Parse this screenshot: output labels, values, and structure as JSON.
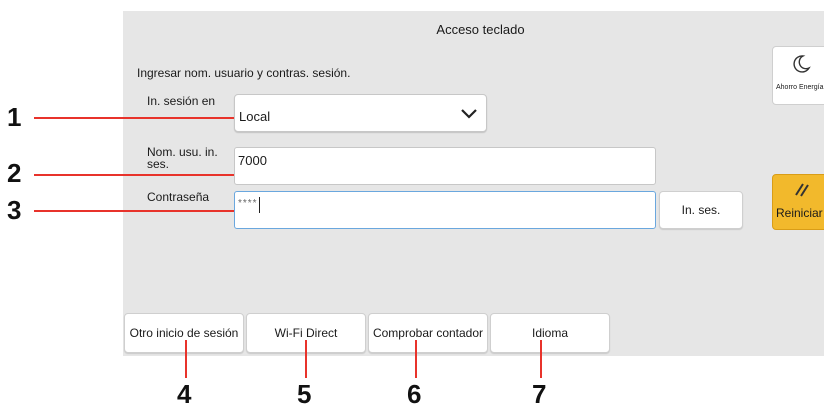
{
  "screen": {
    "title": "Acceso teclado",
    "instruction": "Ingresar nom. usuario y contras. sesión."
  },
  "form": {
    "login_to_label": "In. sesión en",
    "login_to_value": "Local",
    "username_label": "Nom. usu. in. ses.",
    "username_value": "7000",
    "password_label": "Contraseña",
    "password_value": "****",
    "login_button": "In. ses."
  },
  "side": {
    "energy_saver": "Ahorro Energía",
    "reset": "Reiniciar"
  },
  "bottom_buttons": [
    {
      "label": "Otro inicio de sesión"
    },
    {
      "label": "Wi-Fi Direct"
    },
    {
      "label": "Comprobar contador"
    },
    {
      "label": "Idioma"
    }
  ],
  "callouts": [
    "1",
    "2",
    "3",
    "4",
    "5",
    "6",
    "7"
  ],
  "colors": {
    "panel_bg": "#e6e6e6",
    "reset_button": "#f2b92c",
    "leader_line": "#e8332b",
    "focus_border": "#6aa7de"
  }
}
